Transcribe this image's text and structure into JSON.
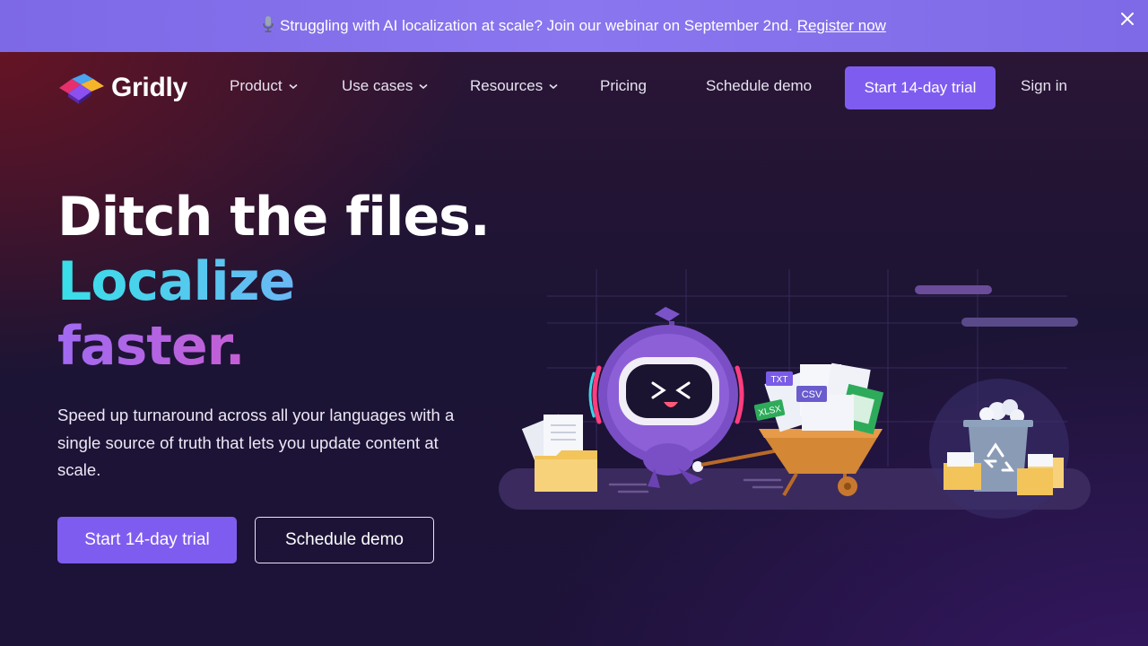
{
  "banner": {
    "icon": "microphone-icon",
    "text": "Struggling with AI localization at scale? Join our webinar on September 2nd.",
    "link": "Register now",
    "close_icon": "close-icon"
  },
  "nav": {
    "brand": "Gridly",
    "items": [
      {
        "label": "Product",
        "has_dropdown": true
      },
      {
        "label": "Use cases",
        "has_dropdown": true
      },
      {
        "label": "Resources",
        "has_dropdown": true
      },
      {
        "label": "Pricing",
        "has_dropdown": false
      }
    ],
    "schedule_demo": "Schedule demo",
    "trial": "Start 14-day trial",
    "sign_in": "Sign in"
  },
  "hero": {
    "line1": "Ditch the files.",
    "line2": "Localize",
    "line3": "faster.",
    "subtitle": "Speed up turnaround across all your languages with a single source of truth that lets you update content at scale.",
    "primary_cta": "Start 14-day trial",
    "secondary_cta": "Schedule demo"
  },
  "illustration": {
    "file_labels": [
      "TXT",
      "CSV",
      "XLSX"
    ],
    "icons": [
      "robot-mascot",
      "wheelbarrow-icon",
      "folder-icon",
      "recycle-bin-icon"
    ]
  },
  "colors": {
    "banner": "#8472ea",
    "accent": "#7f5cf0",
    "background": "#1d1238"
  }
}
